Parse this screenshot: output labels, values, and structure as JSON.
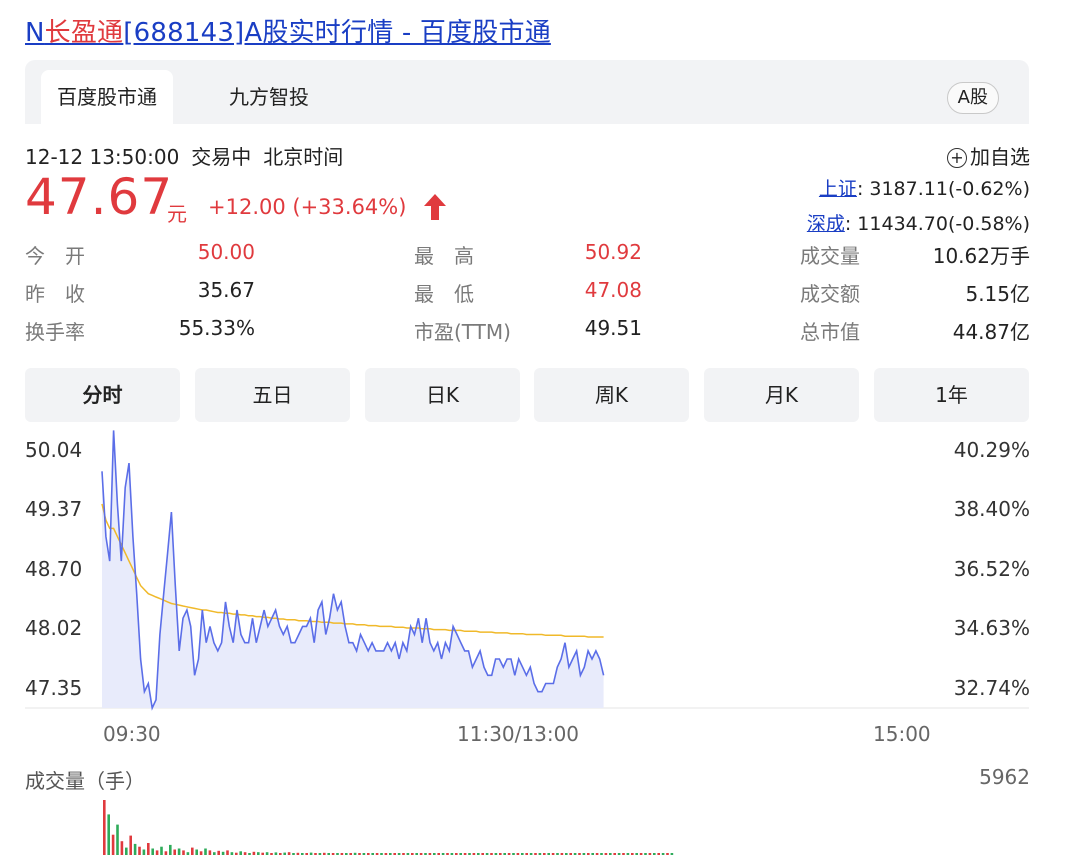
{
  "page_title": {
    "prefix": "N",
    "name": "长盈通",
    "rest": "[688143]A股实时行情 - 百度股市通"
  },
  "tabs": {
    "tab1": "百度股市通",
    "tab2": "九方智投",
    "market_badge": "A股"
  },
  "status": {
    "datetime": "12-12 13:50:00",
    "state": "交易中",
    "tz": "北京时间",
    "watch": "加自选"
  },
  "quote": {
    "price": "47.67",
    "unit": "元",
    "change": "+12.00 (+33.64%)"
  },
  "indices": [
    {
      "name": "上证",
      "value": ": 3187.11(-0.62%)"
    },
    {
      "name": "深成",
      "value": ": 11434.70(-0.58%)"
    }
  ],
  "stats": {
    "open_label": "今　开",
    "open": "50.00",
    "high_label": "最　高",
    "high": "50.92",
    "volume_label": "成交量",
    "volume": "10.62万手",
    "prev_label": "昨　收",
    "prev": "35.67",
    "low_label": "最　低",
    "low": "47.08",
    "amount_label": "成交额",
    "amount": "5.15亿",
    "turnover_label": "换手率",
    "turnover": "55.33%",
    "pe_label": "市盈(TTM)",
    "pe": "49.51",
    "mcap_label": "总市值",
    "mcap": "44.87亿"
  },
  "periods": [
    "分时",
    "五日",
    "日K",
    "周K",
    "月K",
    "1年"
  ],
  "chart_data": {
    "type": "line",
    "y_left_ticks": [
      "50.04",
      "49.37",
      "48.70",
      "48.02",
      "47.35"
    ],
    "y_right_ticks": [
      "40.29%",
      "38.40%",
      "36.52%",
      "34.63%",
      "32.74%"
    ],
    "x_ticks": [
      "09:30",
      "11:30/13:00",
      "15:00"
    ],
    "ylim": [
      47.1,
      50.04
    ],
    "colors": {
      "price": "#5b6ee8",
      "avg": "#f0b92a",
      "up": "#e03a3e",
      "down": "#2eab5a",
      "fill": "#e8ebfb"
    },
    "series": [
      {
        "values": [
          50.0,
          49.2,
          48.9,
          50.5,
          49.6,
          48.9,
          49.8,
          50.1,
          49.2,
          48.5,
          47.7,
          47.3,
          47.4,
          47.1,
          47.2,
          48.0,
          48.5,
          49.0,
          49.5,
          48.6,
          47.8,
          48.2,
          48.3,
          48.1,
          47.5,
          47.7,
          48.3,
          47.9,
          48.1,
          47.9,
          47.8,
          47.9,
          48.4,
          48.1,
          47.9,
          48.3,
          48.0,
          47.9,
          47.9,
          48.2,
          47.9,
          48.1,
          48.3,
          48.1,
          48.2,
          48.3,
          48.1,
          48.0,
          48.1,
          47.9,
          47.9,
          48.0,
          48.1,
          48.1,
          48.2,
          47.9,
          48.3,
          48.4,
          48.0,
          48.2,
          48.5,
          48.3,
          48.4,
          48.1,
          47.9,
          47.9,
          47.8,
          48.0,
          47.9,
          47.8,
          47.9,
          47.8,
          47.8,
          47.8,
          47.9,
          47.8,
          47.9,
          47.7,
          47.9,
          47.8,
          48.1,
          48.0,
          48.2,
          47.9,
          48.2,
          47.9,
          47.8,
          47.9,
          47.7,
          47.9,
          47.8,
          48.1,
          48.0,
          47.9,
          47.8,
          47.8,
          47.6,
          47.7,
          47.8,
          47.6,
          47.5,
          47.5,
          47.7,
          47.7,
          47.6,
          47.7,
          47.7,
          47.5,
          47.7,
          47.6,
          47.5,
          47.6,
          47.4,
          47.3,
          47.3,
          47.4,
          47.4,
          47.4,
          47.6,
          47.7,
          47.9,
          47.6,
          47.7,
          47.8,
          47.5,
          47.6,
          47.8,
          47.7,
          47.8,
          47.7,
          47.5
        ]
      },
      {
        "values": [
          49.6,
          49.4,
          49.3,
          49.3,
          49.2,
          49.1,
          49.0,
          48.9,
          48.8,
          48.7,
          48.6,
          48.55,
          48.5,
          48.48,
          48.46,
          48.44,
          48.42,
          48.4,
          48.38,
          48.37,
          48.36,
          48.35,
          48.34,
          48.33,
          48.32,
          48.31,
          48.3,
          48.3,
          48.29,
          48.28,
          48.27,
          48.27,
          48.26,
          48.26,
          48.25,
          48.25,
          48.24,
          48.24,
          48.23,
          48.23,
          48.22,
          48.22,
          48.21,
          48.21,
          48.2,
          48.2,
          48.19,
          48.19,
          48.18,
          48.18,
          48.18,
          48.17,
          48.17,
          48.17,
          48.16,
          48.16,
          48.16,
          48.15,
          48.15,
          48.15,
          48.14,
          48.14,
          48.14,
          48.13,
          48.13,
          48.13,
          48.12,
          48.12,
          48.12,
          48.11,
          48.11,
          48.11,
          48.1,
          48.1,
          48.1,
          48.1,
          48.09,
          48.09,
          48.09,
          48.08,
          48.08,
          48.08,
          48.08,
          48.07,
          48.07,
          48.07,
          48.06,
          48.06,
          48.06,
          48.06,
          48.05,
          48.05,
          48.05,
          48.05,
          48.04,
          48.04,
          48.04,
          48.04,
          48.03,
          48.03,
          48.03,
          48.03,
          48.02,
          48.02,
          48.02,
          48.02,
          48.01,
          48.01,
          48.01,
          48.01,
          48.0,
          48.0,
          48.0,
          48.0,
          48.0,
          47.99,
          47.99,
          47.99,
          47.99,
          47.99,
          47.98,
          47.98,
          47.98,
          47.98,
          47.98,
          47.98,
          47.97,
          47.97,
          47.97,
          47.97,
          47.97
        ]
      }
    ],
    "volume": {
      "label": "成交量（手）",
      "max_label": "5962",
      "max": 5962,
      "values": [
        5962,
        4400,
        2200,
        3300,
        1500,
        800,
        2100,
        1200,
        900,
        600,
        1300,
        700,
        500,
        900,
        400,
        1100,
        600,
        700,
        500,
        300,
        800,
        600,
        400,
        700,
        500,
        300,
        450,
        350,
        500,
        300,
        250,
        400,
        300,
        200,
        350,
        300,
        250,
        300,
        200,
        280,
        220,
        260,
        300,
        200,
        240,
        180,
        220,
        260,
        200,
        180,
        240,
        200,
        170,
        220,
        180,
        200,
        160,
        240,
        180,
        150,
        200,
        170,
        190,
        150,
        180,
        160,
        140,
        180,
        150,
        170,
        130,
        160,
        150,
        140,
        170,
        130,
        150,
        160,
        120,
        140,
        150,
        130,
        160,
        120,
        140,
        110,
        150,
        130,
        120,
        140,
        110,
        130,
        120,
        100,
        140,
        110,
        120,
        130,
        100,
        120,
        110,
        100,
        130,
        110,
        90,
        120,
        110,
        100,
        120,
        90,
        110,
        100,
        120,
        90,
        100,
        110,
        90,
        100,
        120,
        90,
        100,
        110,
        90,
        100,
        90,
        110,
        90,
        100,
        90,
        100
      ]
    }
  }
}
